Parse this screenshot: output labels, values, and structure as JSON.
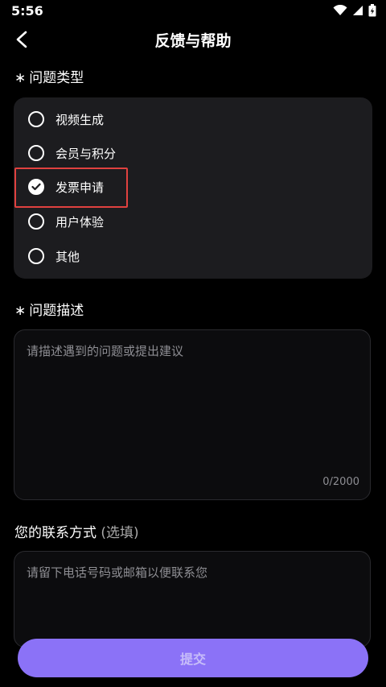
{
  "status_bar": {
    "time": "5:56"
  },
  "nav": {
    "title": "反馈与帮助"
  },
  "issue_type": {
    "label": "问题类型",
    "options": [
      {
        "label": "视频生成",
        "checked": false
      },
      {
        "label": "会员与积分",
        "checked": false
      },
      {
        "label": "发票申请",
        "checked": true
      },
      {
        "label": "用户体验",
        "checked": false
      },
      {
        "label": "其他",
        "checked": false
      }
    ]
  },
  "description": {
    "label": "问题描述",
    "placeholder": "请描述遇到的问题或提出建议",
    "counter": "0/2000"
  },
  "contact": {
    "label": "您的联系方式",
    "optional_label": "(选填)",
    "placeholder": "请留下电话号码或邮箱以便联系您"
  },
  "submit": {
    "label": "提交"
  },
  "colors": {
    "accent": "#8b72f7",
    "highlight": "#e0413f",
    "panel": "#1c1c1f"
  }
}
